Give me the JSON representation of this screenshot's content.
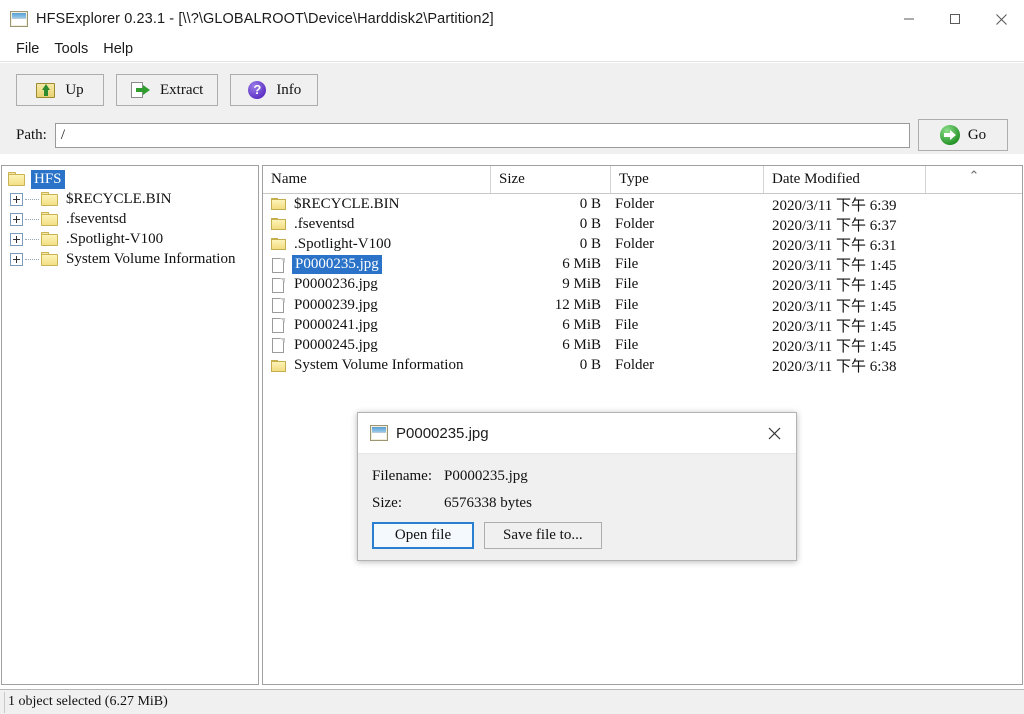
{
  "window": {
    "title": "HFSExplorer 0.23.1 - [\\\\?\\GLOBALROOT\\Device\\Harddisk2\\Partition2]",
    "icon": "photo-icon",
    "controls": {
      "minimize": "minimize-icon",
      "maximize": "maximize-icon",
      "close": "close-icon"
    }
  },
  "menubar": {
    "items": [
      {
        "label": "File"
      },
      {
        "label": "Tools"
      },
      {
        "label": "Help"
      }
    ]
  },
  "toolbar": {
    "buttons": [
      {
        "label": "Up",
        "icon": "folder-up-icon"
      },
      {
        "label": "Extract",
        "icon": "extract-arrow-icon"
      },
      {
        "label": "Info",
        "icon": "info-question-icon"
      }
    ]
  },
  "pathbar": {
    "label": "Path:",
    "value": "/",
    "placeholder": "",
    "go_label": "Go",
    "go_icon": "green-arrow-icon"
  },
  "tree": {
    "root": {
      "label": "HFS",
      "icon": "folder-icon",
      "selected": true
    },
    "children": [
      {
        "label": "$RECYCLE.BIN",
        "icon": "folder-icon",
        "expander": "plus-icon"
      },
      {
        "label": ".fseventsd",
        "icon": "folder-icon",
        "expander": "plus-icon"
      },
      {
        "label": ".Spotlight-V100",
        "icon": "folder-icon",
        "expander": "plus-icon"
      },
      {
        "label": "System Volume Information",
        "icon": "folder-icon",
        "expander": "plus-icon"
      }
    ]
  },
  "filelist": {
    "columns": [
      {
        "label": "Name"
      },
      {
        "label": "Size"
      },
      {
        "label": "Type"
      },
      {
        "label": "Date Modified"
      },
      {
        "label": "",
        "sort_icon": "chevron-up-icon",
        "sort_glyph": "⌃"
      }
    ],
    "rows": [
      {
        "name": "$RECYCLE.BIN",
        "size": "0 B",
        "type": "Folder",
        "date": "2020/3/11 下午 6:39",
        "icon": "folder-icon",
        "selected": false
      },
      {
        "name": ".fseventsd",
        "size": "0 B",
        "type": "Folder",
        "date": "2020/3/11 下午 6:37",
        "icon": "folder-icon",
        "selected": false
      },
      {
        "name": ".Spotlight-V100",
        "size": "0 B",
        "type": "Folder",
        "date": "2020/3/11 下午 6:31",
        "icon": "folder-icon",
        "selected": false
      },
      {
        "name": "P0000235.jpg",
        "size": "6 MiB",
        "type": "File",
        "date": "2020/3/11 下午 1:45",
        "icon": "file-icon",
        "selected": true
      },
      {
        "name": "P0000236.jpg",
        "size": "9 MiB",
        "type": "File",
        "date": "2020/3/11 下午 1:45",
        "icon": "file-icon",
        "selected": false
      },
      {
        "name": "P0000239.jpg",
        "size": "12 MiB",
        "type": "File",
        "date": "2020/3/11 下午 1:45",
        "icon": "file-icon",
        "selected": false
      },
      {
        "name": "P0000241.jpg",
        "size": "6 MiB",
        "type": "File",
        "date": "2020/3/11 下午 1:45",
        "icon": "file-icon",
        "selected": false
      },
      {
        "name": "P0000245.jpg",
        "size": "6 MiB",
        "type": "File",
        "date": "2020/3/11 下午 1:45",
        "icon": "file-icon",
        "selected": false
      },
      {
        "name": "System Volume Information",
        "size": "0 B",
        "type": "Folder",
        "date": "2020/3/11 下午 6:38",
        "icon": "folder-icon",
        "selected": false
      }
    ]
  },
  "dialog": {
    "title": "P0000235.jpg",
    "icon": "photo-icon",
    "close_icon": "close-icon",
    "filename_label": "Filename:",
    "filename_value": "P0000235.jpg",
    "size_label": "Size:",
    "size_value": "6576338 bytes",
    "open_label": "Open file",
    "save_label": "Save file to..."
  },
  "statusbar": {
    "text": "1 object selected (6.27 MiB)"
  },
  "colors": {
    "selection": "#2a73c8",
    "toolbar_bg": "#f0f0f0",
    "focus_border": "#2a7fd0"
  }
}
